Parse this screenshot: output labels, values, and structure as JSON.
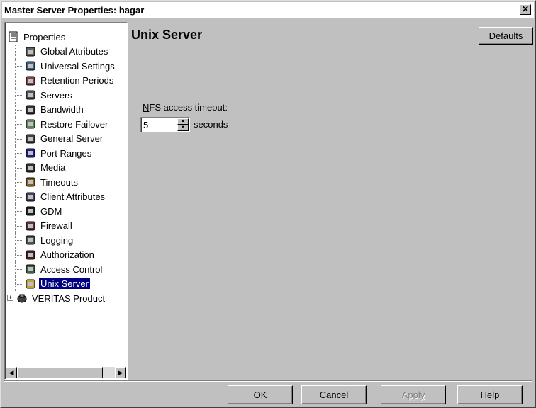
{
  "window": {
    "title": "Master Server Properties: hagar",
    "close_glyph": "✕"
  },
  "tree": {
    "root_label": "Properties",
    "items": [
      {
        "label": "Global Attributes",
        "icon": "globe-icon"
      },
      {
        "label": "Universal Settings",
        "icon": "network-icon"
      },
      {
        "label": "Retention Periods",
        "icon": "calendar-icon"
      },
      {
        "label": "Servers",
        "icon": "server-icon"
      },
      {
        "label": "Bandwidth",
        "icon": "bandwidth-icon"
      },
      {
        "label": "Restore Failover",
        "icon": "failover-icon"
      },
      {
        "label": "General Server",
        "icon": "general-server-icon"
      },
      {
        "label": "Port Ranges",
        "icon": "port-icon"
      },
      {
        "label": "Media",
        "icon": "media-icon"
      },
      {
        "label": "Timeouts",
        "icon": "clock-icon"
      },
      {
        "label": "Client Attributes",
        "icon": "client-icon"
      },
      {
        "label": "GDM",
        "icon": "gdm-icon"
      },
      {
        "label": "Firewall",
        "icon": "firewall-icon"
      },
      {
        "label": "Logging",
        "icon": "logging-icon"
      },
      {
        "label": "Authorization",
        "icon": "authorization-icon"
      },
      {
        "label": "Access Control",
        "icon": "access-control-icon"
      },
      {
        "label": "Unix Server",
        "icon": "unix-server-icon",
        "selected": true
      }
    ],
    "second_root_label": "VERITAS Product",
    "expander": "+"
  },
  "content": {
    "title": "Unix Server",
    "defaults_label_pre": "De",
    "defaults_label_u": "f",
    "defaults_label_post": "aults",
    "nfs_label_u": "N",
    "nfs_label_rest": "FS access timeout:",
    "nfs_value": "5",
    "seconds_label": "seconds"
  },
  "buttons": {
    "ok": "OK",
    "cancel": "Cancel",
    "apply_pre": "Appl",
    "apply_u": "y",
    "help_u": "H",
    "help_rest": "elp"
  },
  "colors": {
    "selection": "#000080",
    "face": "#c0c0c0"
  }
}
